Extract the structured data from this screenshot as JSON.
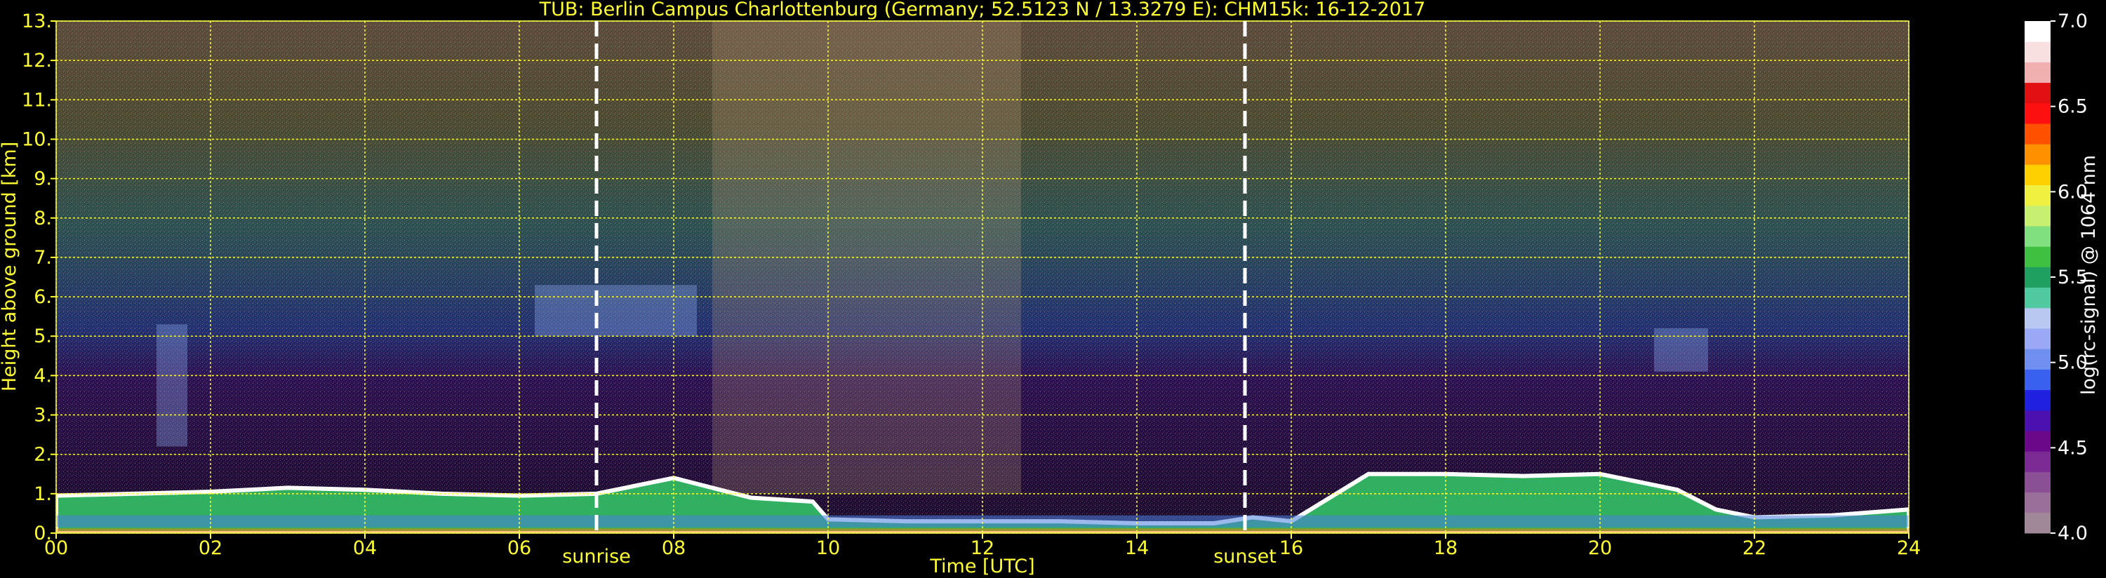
{
  "chart_data": {
    "type": "heatmap",
    "title": "TUB: Berlin Campus Charlottenburg (Germany; 52.5123 N / 13.3279 E):    CHM15k: 16-12-2017",
    "xlabel": "Time [UTC]",
    "ylabel": "Height above ground [km]",
    "xlim": [
      0,
      24
    ],
    "ylim": [
      0,
      13
    ],
    "x_ticks": [
      "00",
      "02",
      "04",
      "06",
      "08",
      "10",
      "12",
      "14",
      "16",
      "18",
      "20",
      "22",
      "24"
    ],
    "y_ticks": [
      "0.",
      "1.",
      "2.",
      "3.",
      "4.",
      "5.",
      "6.",
      "7.",
      "8.",
      "9.",
      "10.",
      "11.",
      "12.",
      "13."
    ],
    "grid": true,
    "colorbar": {
      "label": "log(rc-signal) @ 1064 nm",
      "range": [
        4.0,
        7.0
      ],
      "ticks": [
        "4.0",
        "4.5",
        "5.0",
        "5.5",
        "6.0",
        "6.5",
        "7.0"
      ],
      "colors": [
        "#a08898",
        "#9a6f9a",
        "#8a4f95",
        "#7a2a92",
        "#6a0a8a",
        "#4a10b0",
        "#2020e0",
        "#3a60f0",
        "#6f8ff0",
        "#9aa8f5",
        "#b8c8f0",
        "#50c8a0",
        "#20a060",
        "#40c040",
        "#80e080",
        "#c8f070",
        "#f0f040",
        "#ffd000",
        "#ff9000",
        "#ff5000",
        "#ff1010",
        "#e01010",
        "#f0b0b0",
        "#f8e0e0",
        "#ffffff"
      ]
    },
    "events": [
      {
        "label": "sunrise",
        "x": 7.0
      },
      {
        "label": "sunset",
        "x": 15.4
      }
    ],
    "boundary_layer_top_km": {
      "x": [
        0,
        1,
        2,
        3,
        4,
        5,
        6,
        7,
        7.5,
        8,
        9,
        9.8,
        10,
        11,
        12,
        13,
        14,
        15,
        15.5,
        16,
        17,
        18,
        19,
        20,
        21,
        21.5,
        22,
        23,
        24
      ],
      "y": [
        0.95,
        1.0,
        1.05,
        1.15,
        1.1,
        1.0,
        0.95,
        1.0,
        1.2,
        1.4,
        0.9,
        0.8,
        0.35,
        0.3,
        0.3,
        0.3,
        0.25,
        0.25,
        0.4,
        0.3,
        1.5,
        1.5,
        1.45,
        1.5,
        1.1,
        0.6,
        0.4,
        0.45,
        0.6
      ]
    },
    "cloud_features": [
      {
        "x": [
          6.2,
          8.3
        ],
        "y": [
          5.0,
          6.3
        ]
      },
      {
        "x": [
          1.3,
          1.7
        ],
        "y": [
          2.2,
          5.3
        ]
      },
      {
        "x": [
          20.7,
          21.4
        ],
        "y": [
          4.1,
          5.2
        ]
      }
    ]
  }
}
